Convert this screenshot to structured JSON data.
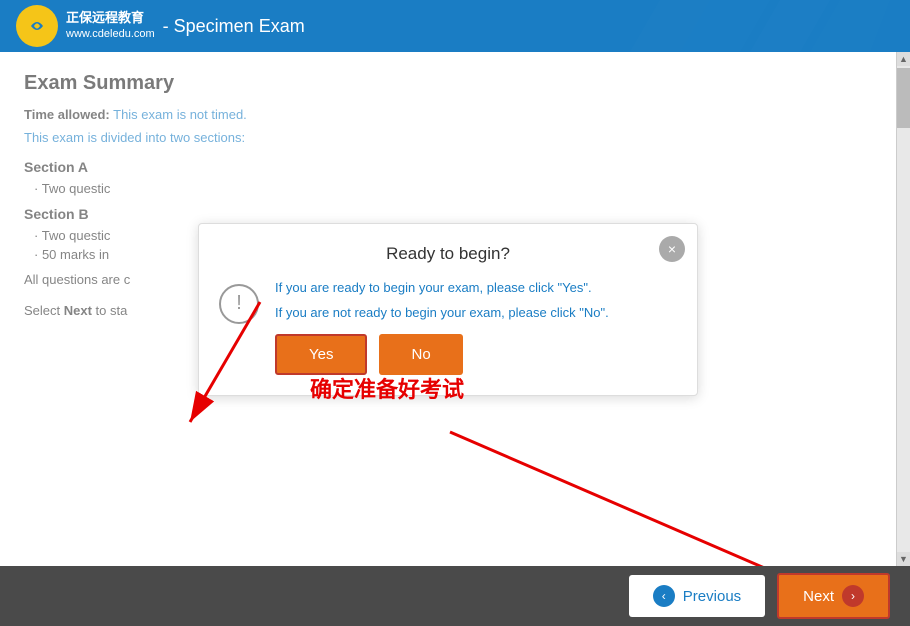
{
  "header": {
    "logo_main": "正保远程教育",
    "logo_sub": "www.cdeledu.com",
    "title": "- Specimen Exam"
  },
  "content": {
    "exam_summary_title": "Exam Summary",
    "time_allowed_label": "Time allowed:",
    "time_allowed_value": "This exam is not timed.",
    "divided_text": "This exam is divided into two sections:",
    "section_a_title": "Section A",
    "section_a_items": [
      "Two questic"
    ],
    "section_b_title": "Section B",
    "section_b_items": [
      "Two questic",
      "50 marks in"
    ],
    "all_questions": "All questions are c",
    "select_next": "Select Next to sta"
  },
  "dialog": {
    "title": "Ready to begin?",
    "close_label": "×",
    "ready_text": "If you are ready to begin your exam, please click \"Yes\".",
    "not_ready_text": "If you are not ready to begin your exam, please click \"No\".",
    "yes_label": "Yes",
    "no_label": "No",
    "annotation_text": "确定准备好考试"
  },
  "footer": {
    "prev_label": "Previous",
    "next_label": "Next"
  }
}
